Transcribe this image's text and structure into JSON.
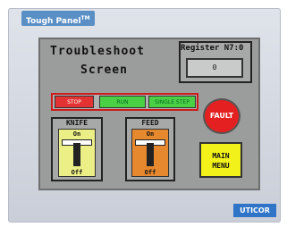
{
  "brand": {
    "name": "Tough Panel",
    "tm": "TM"
  },
  "screen": {
    "title_line1": "Troubleshoot",
    "title_line2": "Screen",
    "register": {
      "label": "Register N7:0",
      "value": "0"
    },
    "modes": {
      "stop": "STOP",
      "run": "RUN",
      "single_step": "SINGLE STEP"
    },
    "fault": {
      "label": "FAULT"
    },
    "knife": {
      "label": "KNIFE",
      "on": "On",
      "off": "Off"
    },
    "feed": {
      "label": "FEED",
      "on": "On",
      "off": "Off"
    },
    "main_menu": {
      "line1": "MAIN",
      "line2": "MENU"
    }
  },
  "logo": "UTICOR",
  "colors": {
    "stop": "#e33232",
    "run": "#4bd045",
    "fault": "#e42020",
    "feed": "#e5882e",
    "knife": "#ecee86",
    "main_menu": "#f2f11a",
    "brand": "#5a8fc6",
    "logo": "#2f74c7"
  }
}
